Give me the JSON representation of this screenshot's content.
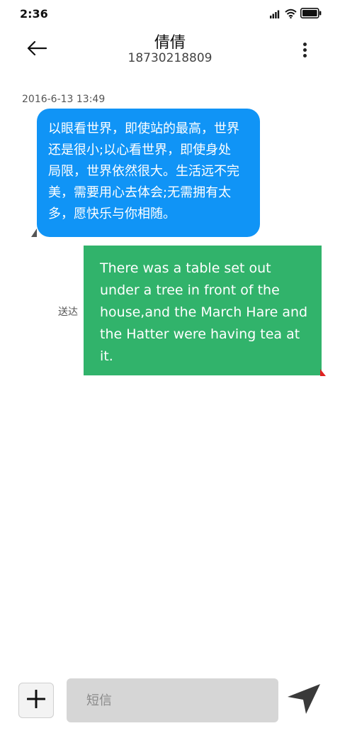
{
  "status_bar": {
    "time": "2:36",
    "icons": [
      "signal-icon",
      "wifi-icon",
      "battery-icon"
    ]
  },
  "header": {
    "contact_name": "倩倩",
    "contact_number": "18730218809",
    "back_icon": "arrow-left-icon",
    "more_icon": "more-vertical-icon"
  },
  "conversation": {
    "timestamp": "2016-6-13 13:49",
    "incoming": {
      "lines": [
        "以眼看世界，即使站的最高，世界",
        "还是很小;以心看世界，即使身处",
        "局限，世界依然很大。生活远不完",
        "美，需要用心去体会;无需拥有太",
        "多，愿快乐与你相随。"
      ],
      "color": "#1094f6"
    },
    "outgoing": {
      "lines": [
        "There was a table set out",
        "under a tree in front of the",
        "house,and the March Hare and",
        "the Hatter were having tea at",
        "it."
      ],
      "status": "送达",
      "color": "#31b36b"
    }
  },
  "composer": {
    "placeholder": "短信",
    "value": "",
    "add_icon": "plus-icon",
    "send_icon": "send-icon"
  }
}
